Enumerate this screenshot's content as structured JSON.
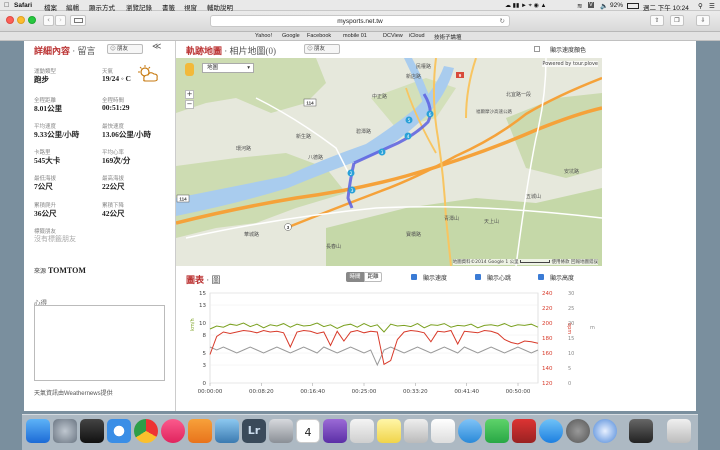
{
  "menubar": {
    "app": "Safari",
    "items": [
      "檔案",
      "編輯",
      "顯示方式",
      "瀏覽記錄",
      "書籤",
      "視窗",
      "輔助說明"
    ],
    "battery": "92%",
    "clock": "週二 下午 10:24"
  },
  "browser": {
    "url": "mysports.net.tw",
    "favorites": [
      "Yahoo!",
      "Google",
      "Facebook",
      "mobile 01",
      "DCView",
      "iCloud",
      "技術子論壇"
    ]
  },
  "detail": {
    "title": "詳細內容",
    "subtitle": "留言",
    "friend_btn": "朋友",
    "collapse": "≪",
    "stats": [
      {
        "label": "運動類型",
        "value": "跑步"
      },
      {
        "label": "天氣",
        "value": "19/24 ◦ C"
      },
      {
        "label": "全程距離",
        "value": "8.01公里"
      },
      {
        "label": "全程時間",
        "value": "00:51:29"
      },
      {
        "label": "平均速度",
        "value": "9.33公里/小時"
      },
      {
        "label": "最快速度",
        "value": "13.06公里/小時"
      },
      {
        "label": "卡路里",
        "value": "545大卡"
      },
      {
        "label": "平均心率",
        "value": "169次/分"
      },
      {
        "label": "最低海拔",
        "value": "7公尺"
      },
      {
        "label": "最高海拔",
        "value": "22公尺"
      },
      {
        "label": "累積爬升",
        "value": "36公尺"
      },
      {
        "label": "累積下降",
        "value": "42公尺"
      }
    ],
    "tagged_label": "標籤朋友",
    "tagged_value": "沒有標籤朋友",
    "source_label": "來源",
    "source_value": "TOMTOM",
    "notes_label": "心得",
    "weather_credit": "天氣資訊由Weathernews提供"
  },
  "map": {
    "title": "軌跡地圖",
    "subtitle": "相片地圖(0)",
    "friend_btn": "朋友",
    "speed_color_label": "顯示速度顏色",
    "map_type": "地圖",
    "powered_by": "Powered by tour.plove",
    "copyright": "地圖資料©2014 Google",
    "scale": "1 公里",
    "terms": "使用條款",
    "report": "回報地圖錯誤",
    "places": [
      "八德路",
      "新生路",
      "青潭山",
      "天上山",
      "五城山",
      "安坑路",
      "長春山",
      "華城路",
      "中正路",
      "福爾摩沙高速公路",
      "環河路",
      "碧潭路",
      "寶橋路",
      "新店路",
      "民權路",
      "北宜路一段"
    ],
    "road_numbers": [
      "114",
      "114",
      "3",
      "9"
    ],
    "zoom_in": "+",
    "zoom_out": "−",
    "markers": [
      "3",
      "4",
      "5",
      "6",
      "2",
      "3"
    ]
  },
  "chart": {
    "title": "圖表",
    "subtitle": "圖",
    "tab_time": "時間",
    "tab_distance": "距離",
    "show_speed": "顯示速度",
    "show_hr": "顯示心跳",
    "show_alt": "顯示高度",
    "unit_speed": "km/h",
    "unit_hr": "bpm",
    "unit_alt": "m"
  },
  "chart_data": {
    "type": "line",
    "x": [
      "00:00:00",
      "00:08:20",
      "00:16:40",
      "00:25:00",
      "00:33:20",
      "00:41:40",
      "00:50:00"
    ],
    "y_speed_ticks": [
      0,
      3,
      5,
      8,
      10,
      13,
      15
    ],
    "y_hr_ticks": [
      120,
      140,
      160,
      180,
      200,
      220,
      240
    ],
    "y_alt_ticks": [
      0,
      5,
      10,
      15,
      20,
      25,
      30
    ],
    "ylim_speed": [
      0,
      15
    ],
    "ylim_hr": [
      120,
      240
    ],
    "ylim_alt": [
      0,
      30
    ],
    "series": [
      {
        "color": "#7aa020",
        "axis": "speed",
        "values": [
          9,
          9.5,
          9.3,
          9.8,
          9.6,
          10.0,
          9.4,
          9.8,
          9.2,
          9.7,
          9.5,
          9.9,
          9.3,
          9.8,
          9.5,
          9.6,
          10.0,
          9.4,
          9.7,
          9.1,
          9.6,
          9.8,
          9.3,
          9.9,
          9.4,
          9.7,
          8.5,
          9.8,
          9.5,
          9.6,
          9.4,
          9.9,
          9.2,
          9.7,
          9.6,
          9.9,
          9.3,
          9.6,
          9.5,
          9.8,
          9.2,
          9.6,
          9.7,
          9.5,
          9.9,
          9.4,
          9.7,
          9.6,
          9.8,
          9.3
        ]
      },
      {
        "color": "#d83a2a",
        "axis": "hr",
        "values": [
          158,
          182,
          188,
          186,
          188,
          190,
          189,
          187,
          190,
          188,
          189,
          187,
          168,
          188,
          190,
          189,
          186,
          188,
          170,
          189,
          176,
          188,
          190,
          187,
          189,
          188,
          145,
          150,
          178,
          188,
          190,
          189,
          187,
          175,
          189,
          188,
          190,
          172,
          189,
          188,
          187,
          190,
          189,
          186,
          178,
          174,
          172,
          176,
          175,
          173
        ]
      },
      {
        "color": "#9a9a9a",
        "axis": "alt",
        "values": [
          12,
          11,
          12,
          11,
          10,
          11,
          12,
          11,
          10,
          11,
          12,
          11,
          10,
          11,
          12,
          11,
          10,
          12,
          11,
          10,
          11,
          12,
          11,
          10,
          11,
          6,
          11,
          12,
          11,
          10,
          11,
          12,
          11,
          10,
          11,
          12,
          11,
          10,
          12,
          11,
          10,
          11,
          12,
          11,
          10,
          11,
          12,
          11,
          10,
          11
        ]
      }
    ]
  }
}
